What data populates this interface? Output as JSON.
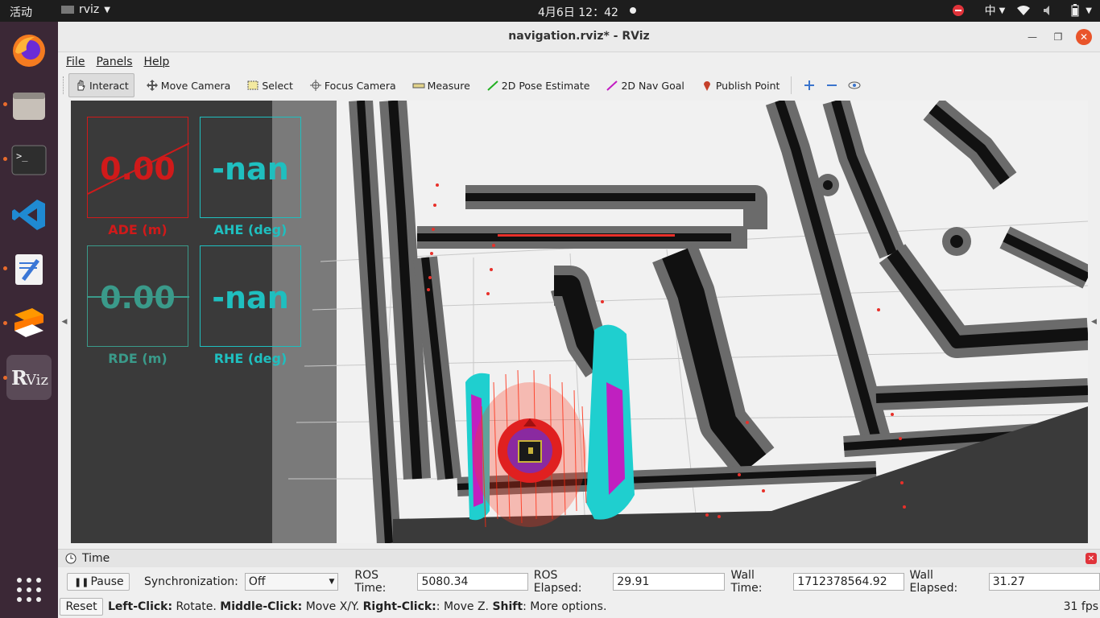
{
  "topbar": {
    "activities": "活动",
    "app_name": "rviz",
    "clock": "4月6日  12：42",
    "input_method": "中"
  },
  "window": {
    "title": "navigation.rviz* - RViz"
  },
  "menu": {
    "file": "File",
    "panels": "Panels",
    "help": "Help"
  },
  "toolbar": {
    "interact": "Interact",
    "move_camera": "Move Camera",
    "select": "Select",
    "focus_camera": "Focus Camera",
    "measure": "Measure",
    "pose_estimate": "2D Pose Estimate",
    "nav_goal": "2D Nav Goal",
    "publish_point": "Publish Point"
  },
  "overlay": {
    "ade": {
      "value": "0.00",
      "label": "ADE (m)",
      "color": "#d01a1a"
    },
    "ahe": {
      "value": "-nan",
      "label": "AHE (deg)",
      "color": "#1fbfbf"
    },
    "rde": {
      "value": "0.00",
      "label": "RDE (m)",
      "color": "#3a9a8a"
    },
    "rhe": {
      "value": "-nan",
      "label": "RHE (deg)",
      "color": "#1fbfbf"
    }
  },
  "time_panel": {
    "title": "Time",
    "pause": "Pause",
    "sync_label": "Synchronization:",
    "sync_value": "Off",
    "ros_time_label": "ROS Time:",
    "ros_time": "5080.34",
    "ros_elapsed_label": "ROS Elapsed:",
    "ros_elapsed": "29.91",
    "wall_time_label": "Wall Time:",
    "wall_time": "1712378564.92",
    "wall_elapsed_label": "Wall Elapsed:",
    "wall_elapsed": "31.27"
  },
  "status": {
    "reset": "Reset",
    "hint_1": "Left-Click:",
    "hint_1_text": " Rotate. ",
    "hint_2": "Middle-Click:",
    "hint_2_text": " Move X/Y. ",
    "hint_3": "Right-Click:",
    "hint_3_text": ": Move Z. ",
    "hint_4": "Shift",
    "hint_4_text": ": More options.",
    "fps": "31 fps"
  },
  "colors": {
    "accent_red": "#e8302a",
    "cyan": "#1fbfbf",
    "magenta": "#c020c0"
  }
}
